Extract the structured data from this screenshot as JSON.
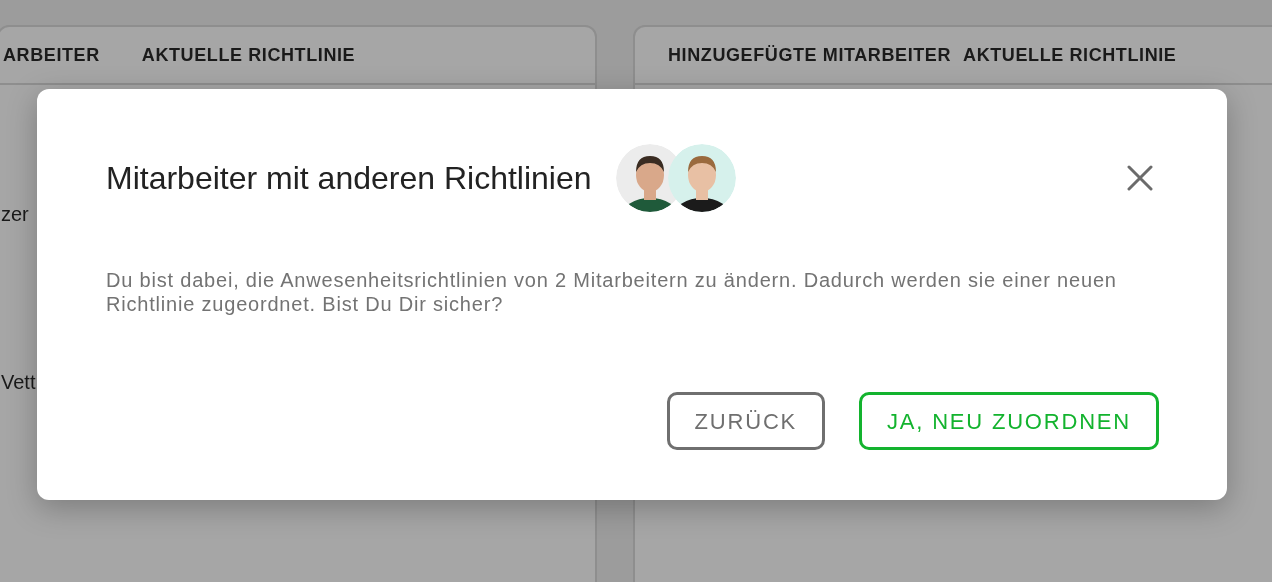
{
  "background": {
    "left_panel": {
      "columns": [
        "ARBEITER",
        "AKTUELLE RICHTLINIE"
      ],
      "rows": [
        "zer",
        "Vett"
      ]
    },
    "right_panel": {
      "columns": [
        "HINZUGEFÜGTE MITARBEITER",
        "AKTUELLE RICHTLINIE"
      ]
    }
  },
  "dialog": {
    "title": "Mitarbeiter mit anderen Richtlinien",
    "message": "Du bist dabei, die Anwesenheitsrichtlinien von 2 Mitarbeitern zu ändern. Dadurch werden sie einer neuen Richtlinie zugeordnet. Bist Du Dir sicher?",
    "buttons": [
      {
        "label": "ZURÜCK",
        "kind": "secondary"
      },
      {
        "label": "JA, NEU ZUORDNEN",
        "kind": "primary"
      }
    ]
  }
}
